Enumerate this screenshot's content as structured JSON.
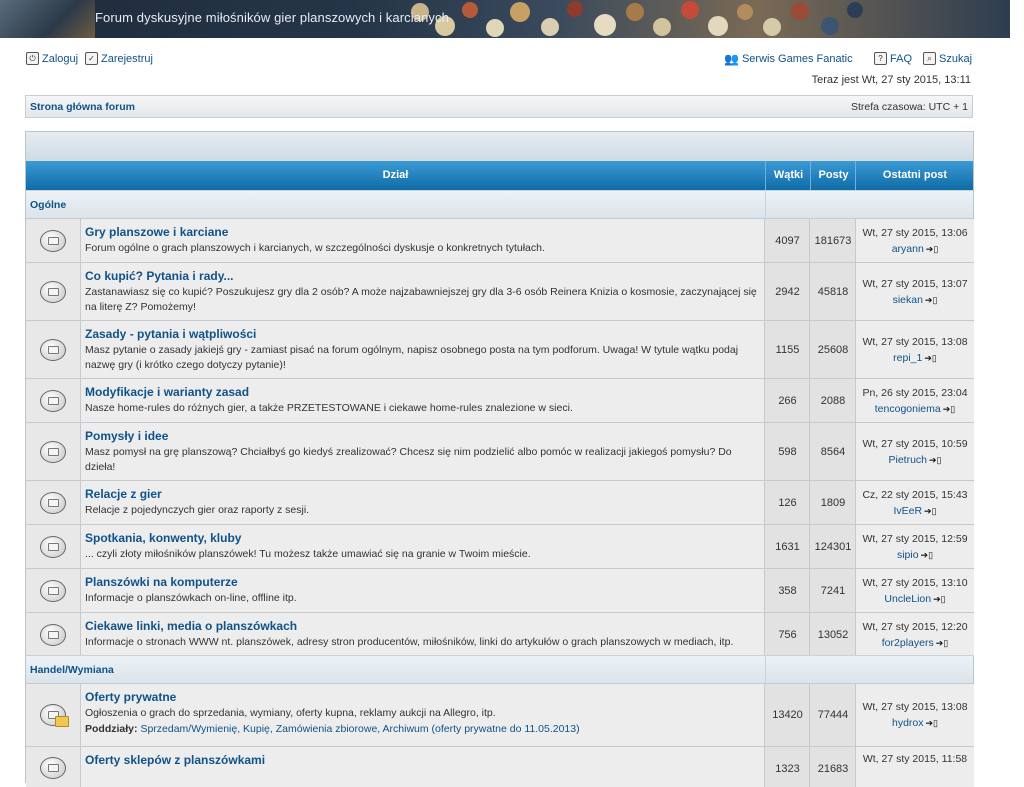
{
  "banner": {
    "title": "Forum dyskusyjne miłośników gier planszowych i karcianych"
  },
  "nav": {
    "login": "Zaloguj",
    "register": "Zarejestruj",
    "games_fanatic": "Serwis Games Fanatic",
    "faq": "FAQ",
    "search": "Szukaj",
    "now": "Teraz jest Wt, 27 sty 2015, 13:11"
  },
  "breadcrumb": {
    "home": "Strona główna forum",
    "timezone": "Strefa czasowa: UTC + 1"
  },
  "table": {
    "headers": {
      "forum": "Dział",
      "topics": "Wątki",
      "posts": "Posty",
      "last": "Ostatni post"
    },
    "categories": [
      {
        "name": "Ogólne",
        "forums": [
          {
            "title": "Gry planszowe i karciane",
            "desc": "Forum ogólne o grach planszowych i karcianych, w szczególności dyskusje o konkretnych tytułach.",
            "topics": "4097",
            "posts": "181673",
            "last_date": "Wt, 27 sty 2015, 13:06",
            "last_user": "aryann"
          },
          {
            "title": "Co kupić? Pytania i rady...",
            "desc": "Zastanawiasz się co kupić? Poszukujesz gry dla 2 osób? A może najzabawniejszej gry dla 3-6 osób Reinera Knizia o kosmosie, zaczynającej się na literę Z? Pomożemy!",
            "topics": "2942",
            "posts": "45818",
            "last_date": "Wt, 27 sty 2015, 13:07",
            "last_user": "siekan"
          },
          {
            "title": "Zasady - pytania i wątpliwości",
            "desc": "Masz pytanie o zasady jakiejś gry - zamiast pisać na forum ogólnym, napisz osobnego posta na tym podforum. Uwaga! W tytule wątku podaj nazwę gry (i krótko czego dotyczy pytanie)!",
            "topics": "1155",
            "posts": "25608",
            "last_date": "Wt, 27 sty 2015, 13:08",
            "last_user": "repi_1"
          },
          {
            "title": "Modyfikacje i warianty zasad",
            "desc": "Nasze home-rules do różnych gier, a także PRZETESTOWANE i ciekawe home-rules znalezione w sieci.",
            "topics": "266",
            "posts": "2088",
            "last_date": "Pn, 26 sty 2015, 23:04",
            "last_user": "tencogoniema"
          },
          {
            "title": "Pomysły i idee",
            "desc": "Masz pomysł na grę planszową? Chciałbyś go kiedyś zrealizować? Chcesz się nim podzielić albo pomóc w realizacji jakiegoś pomysłu? Do dzieła!",
            "topics": "598",
            "posts": "8564",
            "last_date": "Wt, 27 sty 2015, 10:59",
            "last_user": "Pietruch"
          },
          {
            "title": "Relacje z gier",
            "desc": "Relacje z pojedynczych gier oraz raporty z sesji.",
            "topics": "126",
            "posts": "1809",
            "last_date": "Cz, 22 sty 2015, 15:43",
            "last_user": "IvEeR"
          },
          {
            "title": "Spotkania, konwenty, kluby",
            "desc": "... czyli złoty miłośników planszówek! Tu możesz także umawiać się na granie w Twoim mieście.",
            "topics": "1631",
            "posts": "124301",
            "last_date": "Wt, 27 sty 2015, 12:59",
            "last_user": "sipio"
          },
          {
            "title": "Planszówki na komputerze",
            "desc": "Informacje o planszówkach on-line, offline itp.",
            "topics": "358",
            "posts": "7241",
            "last_date": "Wt, 27 sty 2015, 13:10",
            "last_user": "UncleLion"
          },
          {
            "title": "Ciekawe linki, media o planszówkach",
            "desc": "Informacje o stronach WWW nt. planszówek, adresy stron producentów, miłośników, linki do artykułów o grach planszowych w mediach, itp.",
            "topics": "756",
            "posts": "13052",
            "last_date": "Wt, 27 sty 2015, 12:20",
            "last_user": "for2players"
          }
        ]
      },
      {
        "name": "Handel/Wymiana",
        "forums": [
          {
            "title": "Oferty prywatne",
            "desc": "Ogłoszenia o grach do sprzedania, wymiany, oferty kupna, reklamy aukcji na Allegro, itp.",
            "subforums_label": "Poddziały:",
            "subforums": "Sprzedam/Wymienię, Kupię, Zamówienia zbiorowe, Archiwum (oferty prywatne do 11.05.2013)",
            "topics": "13420",
            "posts": "77444",
            "last_date": "Wt, 27 sty 2015, 13:08",
            "last_user": "hydrox"
          },
          {
            "title": "Oferty sklepów z planszówkami",
            "desc": "",
            "topics": "1323",
            "posts": "21683",
            "last_date": "Wt, 27 sty 2015, 11:58",
            "last_user": ""
          }
        ]
      }
    ]
  },
  "icons": {
    "login": "login-icon",
    "register": "register-icon",
    "games_fanatic": "people-icon",
    "faq": "faq-icon",
    "search": "search-icon",
    "forum": "forum-read-icon",
    "goto": "goto-last-post-icon"
  }
}
